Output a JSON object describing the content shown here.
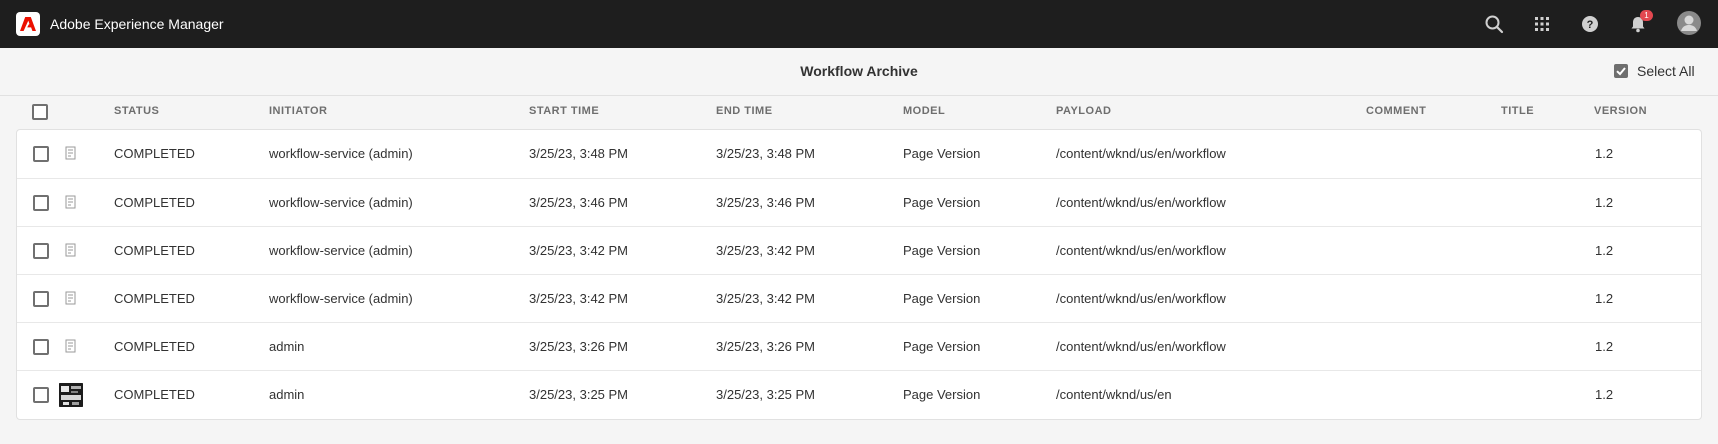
{
  "app": {
    "title": "Adobe Experience Manager",
    "brand_color": "#eb1000"
  },
  "topbar": {
    "icons": [
      "search-icon",
      "apps-grid-icon",
      "help-icon",
      "bell-icon",
      "avatar"
    ],
    "notification_count": "1"
  },
  "page": {
    "title": "Workflow Archive",
    "select_all_label": "Select All"
  },
  "table": {
    "columns": {
      "status": "STATUS",
      "initiator": "INITIATOR",
      "start_time": "START TIME",
      "end_time": "END TIME",
      "model": "MODEL",
      "payload": "PAYLOAD",
      "comment": "COMMENT",
      "title": "TITLE",
      "version": "VERSION"
    },
    "rows": [
      {
        "status": "COMPLETED",
        "initiator": "workflow-service (admin)",
        "start_time": "3/25/23, 3:48 PM",
        "end_time": "3/25/23, 3:48 PM",
        "model": "Page Version",
        "payload": "/content/wknd/us/en/workflow",
        "comment": "",
        "title": "",
        "version": "1.2",
        "icon": "page-icon"
      },
      {
        "status": "COMPLETED",
        "initiator": "workflow-service (admin)",
        "start_time": "3/25/23, 3:46 PM",
        "end_time": "3/25/23, 3:46 PM",
        "model": "Page Version",
        "payload": "/content/wknd/us/en/workflow",
        "comment": "",
        "title": "",
        "version": "1.2",
        "icon": "page-icon"
      },
      {
        "status": "COMPLETED",
        "initiator": "workflow-service (admin)",
        "start_time": "3/25/23, 3:42 PM",
        "end_time": "3/25/23, 3:42 PM",
        "model": "Page Version",
        "payload": "/content/wknd/us/en/workflow",
        "comment": "",
        "title": "",
        "version": "1.2",
        "icon": "page-icon"
      },
      {
        "status": "COMPLETED",
        "initiator": "workflow-service (admin)",
        "start_time": "3/25/23, 3:42 PM",
        "end_time": "3/25/23, 3:42 PM",
        "model": "Page Version",
        "payload": "/content/wknd/us/en/workflow",
        "comment": "",
        "title": "",
        "version": "1.2",
        "icon": "page-icon"
      },
      {
        "status": "COMPLETED",
        "initiator": "admin",
        "start_time": "3/25/23, 3:26 PM",
        "end_time": "3/25/23, 3:26 PM",
        "model": "Page Version",
        "payload": "/content/wknd/us/en/workflow",
        "comment": "",
        "title": "",
        "version": "1.2",
        "icon": "page-icon"
      },
      {
        "status": "COMPLETED",
        "initiator": "admin",
        "start_time": "3/25/23, 3:25 PM",
        "end_time": "3/25/23, 3:25 PM",
        "model": "Page Version",
        "payload": "/content/wknd/us/en",
        "comment": "",
        "title": "",
        "version": "1.2",
        "icon": "page-thumbnail"
      }
    ]
  }
}
